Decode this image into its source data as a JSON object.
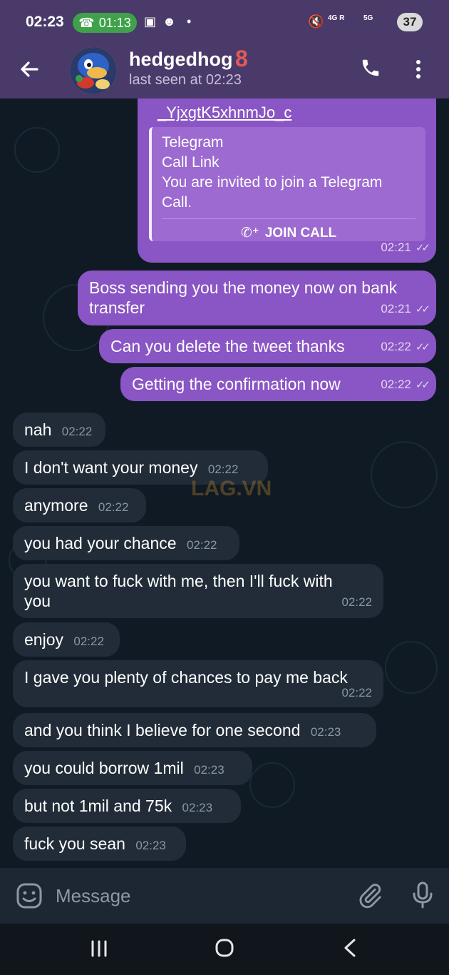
{
  "status_bar": {
    "time": "02:23",
    "call_timer": "01:13",
    "network_a": "4G R",
    "network_b": "5G",
    "battery": "37"
  },
  "header": {
    "name": "hedgedhog",
    "badge": "8",
    "last_seen": "last seen at 02:23"
  },
  "outgoing": {
    "link_tail": "_YjxgtK5xhnmJo_c",
    "preview_site": "Telegram",
    "preview_title": "Call Link",
    "preview_desc": "You are invited to join a Telegram Call.",
    "join_label": "JOIN CALL",
    "link_time": "02:21",
    "messages": [
      {
        "text": "Boss sending you the money now on bank transfer",
        "line1": "Boss sending you the money now on bank",
        "line2": "transfer",
        "time": "02:21"
      },
      {
        "text": "Can you delete the tweet thanks",
        "time": "02:22"
      },
      {
        "text": "Getting the confirmation now",
        "time": "02:22"
      }
    ]
  },
  "incoming": [
    {
      "text": "nah",
      "time": "02:22"
    },
    {
      "text": "I don't want your money",
      "time": "02:22"
    },
    {
      "text": "anymore",
      "time": "02:22"
    },
    {
      "text": "you had your chance",
      "time": "02:22"
    },
    {
      "text": "you want to fuck with me, then I'll fuck with you",
      "line1": "you want to fuck with me, then I'll fuck with",
      "line2": "you",
      "time": "02:22"
    },
    {
      "text": "enjoy",
      "time": "02:22"
    },
    {
      "text": "I gave you plenty of chances to pay me back",
      "time": "02:22"
    },
    {
      "text": "and you think I believe for one second",
      "time": "02:23"
    },
    {
      "text": "you could borrow 1mil",
      "time": "02:23"
    },
    {
      "text": "but not 1mil and 75k",
      "time": "02:23"
    },
    {
      "text": "fuck you sean",
      "time": "02:23"
    }
  ],
  "composer": {
    "placeholder": "Message"
  },
  "watermark": "LAG.VN",
  "colors": {
    "header_bg": "#4a3a6a",
    "outgoing_bubble": "#8a55c4",
    "incoming_bubble": "#212c38",
    "chat_bg": "#0f1a24",
    "call_pill": "#3fa24a"
  },
  "icons": [
    "back-arrow-icon",
    "phone-icon",
    "more-vert-icon",
    "emoji-icon",
    "attach-icon",
    "mic-icon",
    "recents-icon",
    "home-icon",
    "nav-back-icon",
    "double-check-icon",
    "add-call-icon"
  ]
}
